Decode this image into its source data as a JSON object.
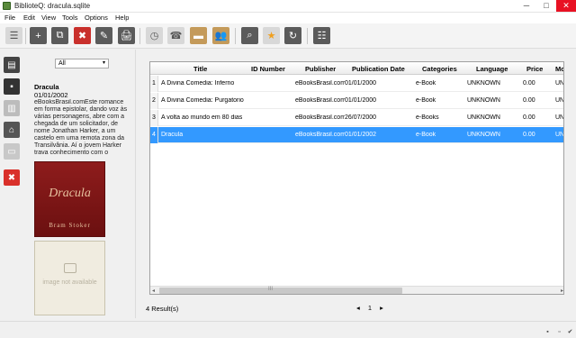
{
  "window": {
    "title": "BiblioteQ: dracula.sqlite",
    "min": "─",
    "max": "□",
    "close": "✕"
  },
  "menu": [
    "File",
    "Edit",
    "View",
    "Tools",
    "Options",
    "Help"
  ],
  "toolbar": {
    "details": "☰",
    "add": "+",
    "copy": "⧉",
    "delete": "✖",
    "edit": "✎",
    "print": "🖨",
    "clock": "◷",
    "phone": "☎",
    "folder": "▬",
    "members": "👥",
    "search": "⌕",
    "star": "★",
    "refresh": "↻",
    "list": "☷"
  },
  "sidebar": {
    "briefcase": "▤",
    "notes": "▪",
    "library": "▥",
    "home": "⌂",
    "cards": "▭",
    "exit": "✖"
  },
  "detail": {
    "filter": "All",
    "filter_arrow": "▾",
    "book_title": "Dracula",
    "book_date": "01/01/2002",
    "description": "eBooksBrasil.comEste romance em forma epistolar, dando voz às várias personagens, abre com a chegada de um solicitador, de nome Jonathan Harker, a um castelo em uma remota zona da Transilvânia. Aí o jovem Harker trava conhecimento com o excêntrico",
    "cover_title": "Dracula",
    "cover_author": "Bram Stoker",
    "noimage_text": "image not available"
  },
  "table": {
    "headers": [
      "Title",
      "ID Number",
      "Publisher",
      "Publication Date",
      "Categories",
      "Language",
      "Price",
      "Mo"
    ],
    "rows": [
      {
        "n": "1",
        "title": "A Divina Comedia: Inferno",
        "id": "",
        "publisher": "eBooksBrasil.com",
        "date": "01/01/2000",
        "category": "e-Book",
        "language": "UNKNOWN",
        "price": "0.00",
        "mo": "UN"
      },
      {
        "n": "2",
        "title": "A Divina Comedia: Purgatorio",
        "id": "",
        "publisher": "eBooksBrasil.com",
        "date": "01/01/2000",
        "category": "e-Book",
        "language": "UNKNOWN",
        "price": "0.00",
        "mo": "UN"
      },
      {
        "n": "3",
        "title": "A volta ao mundo em 80 dias",
        "id": "",
        "publisher": "eBooksBrasil.com",
        "date": "26/07/2000",
        "category": "e-Books",
        "language": "UNKNOWN",
        "price": "0.00",
        "mo": "UN"
      },
      {
        "n": "4",
        "title": "Dracula",
        "id": "",
        "publisher": "eBooksBrasil.com",
        "date": "01/01/2002",
        "category": "e-Book",
        "language": "UNKNOWN",
        "price": "0.00",
        "mo": "UN"
      }
    ],
    "selected_row": 4,
    "scroll_left": "◂",
    "scroll_right": "▸",
    "scroll_grip": "III"
  },
  "footer": {
    "results": "4 Result(s)",
    "prev": "◂",
    "page": "1",
    "next": "▸"
  },
  "status": {
    "db": "▪",
    "doc": "▫",
    "check": "✔"
  },
  "colors": {
    "selected_row": "#3399ff",
    "cover": "#8e1c1c",
    "close": "#e81123"
  }
}
